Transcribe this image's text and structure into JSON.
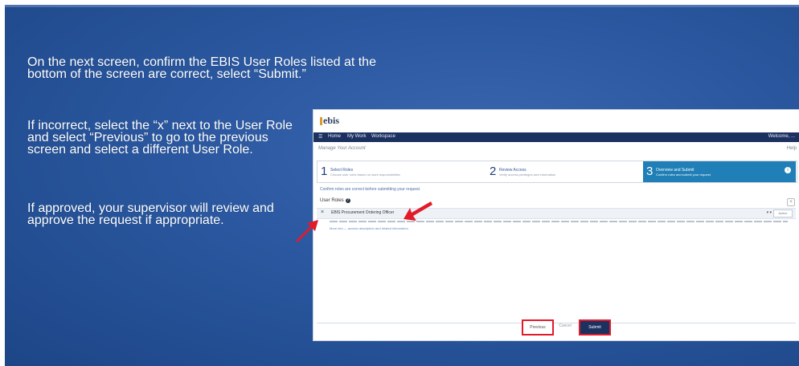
{
  "slide": {
    "p1": "On the next screen, confirm the EBIS User Roles listed at the bottom of the screen are correct, select “Submit.”",
    "p2": "If incorrect, select the “x” next to the User Role and select “Previous” to go to the previous screen and select a different User Role.",
    "p3": "If approved, your supervisor will review and approve the request if appropriate."
  },
  "screenshot": {
    "brand": "ebis",
    "nav": [
      "Home",
      "My Work",
      "Workspace"
    ],
    "user": "Welcome, ...",
    "subtitle": "Manage Your Account",
    "help": "Help",
    "steps": [
      {
        "num": "1",
        "label": "Select Roles",
        "hint": "Choose user roles based on work responsibilities"
      },
      {
        "num": "2",
        "label": "Review Access",
        "hint": "Verify access privileges and information"
      },
      {
        "num": "3",
        "label": "Overview and Submit",
        "hint": "Confirm roles and submit your request"
      }
    ],
    "info_icon": "i",
    "ok_line": "Confirm roles are correct before submitting your request.",
    "roles_header": "User Roles",
    "q_icon": "?",
    "plus": "+",
    "role_x": "×",
    "role_name": "EBIS Procurement Ordering Officer",
    "role_ctrl": "▾  ▾",
    "role_pick": "Active",
    "desc_link": "More info — access description and related information",
    "buttons": {
      "previous": "Previous",
      "cancel": "Cancel",
      "submit": "Submit"
    }
  },
  "colors": {
    "slide_bg": "#2a579f",
    "nav": "#1d3160",
    "step_active": "#1f7fb6",
    "highlight": "#e21b2b"
  }
}
